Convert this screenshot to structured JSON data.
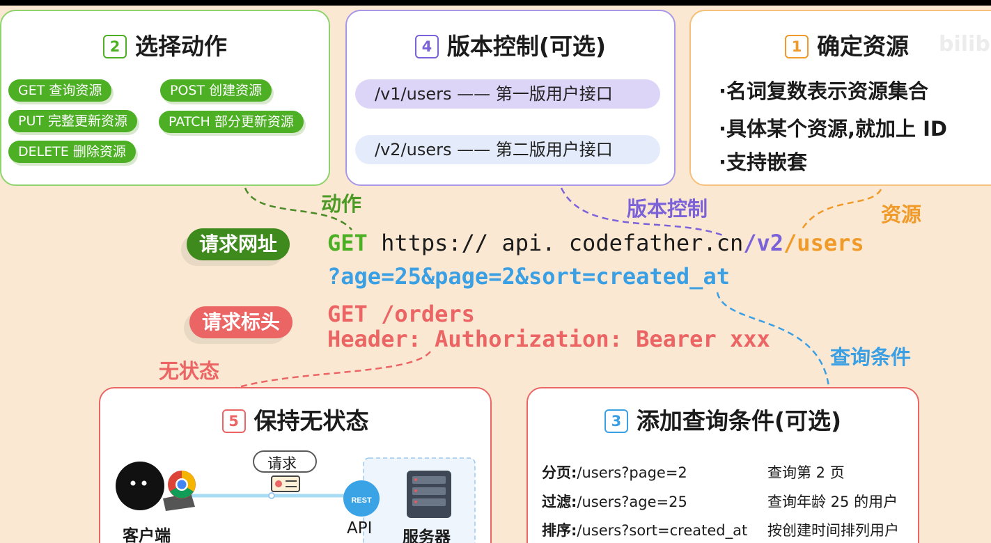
{
  "watermark": "bilib",
  "cards": {
    "actions": {
      "num": "2",
      "title": "选择动作",
      "pills": [
        "GET 查询资源",
        "POST 创建资源",
        "PUT 完整更新资源",
        "PATCH 部分更新资源",
        "DELETE 删除资源"
      ]
    },
    "version": {
      "num": "4",
      "title": "版本控制(可选)",
      "items": [
        "/v1/users —— 第一版用户接口",
        "/v2/users —— 第二版用户接口"
      ]
    },
    "resource": {
      "num": "1",
      "title": "确定资源",
      "bullets": [
        "·名词复数表示资源集合",
        "·具体某个资源,就加上 ID",
        "·支持嵌套"
      ]
    },
    "stateless": {
      "num": "5",
      "title": "保持无状态",
      "request_label": "请求",
      "client": "客户端",
      "api": "API",
      "server": "服务器",
      "rest": "REST"
    },
    "query": {
      "num": "3",
      "title": "添加查询条件(可选)",
      "rows": [
        {
          "label": "分页:",
          "url": "/users?page=2",
          "desc": "查询第 2 页"
        },
        {
          "label": "过滤:",
          "url": "/users?age=25",
          "desc": "查询年龄 25 的用户"
        },
        {
          "label": "排序:",
          "url": "/users?sort=created_at",
          "desc": "按创建时间排列用户"
        }
      ]
    }
  },
  "labels": {
    "action": "动作",
    "version": "版本控制",
    "resource": "资源",
    "stateless": "无状态",
    "query": "查询条件"
  },
  "tags": {
    "url": "请求网址",
    "header": "请求标头"
  },
  "url": {
    "method": "GET",
    "host": "https:// api. codefather.cn",
    "slash": "/",
    "version": "v2",
    "resource": "/users",
    "query": "?age=25&page=2&sort=created_at"
  },
  "header_lines": [
    "GET /orders",
    "Header: Authorization: Bearer xxx"
  ],
  "colors": {
    "green": "#4caf24",
    "purple": "#7b62d8",
    "orange": "#f09a2a",
    "blue": "#3b9fe4",
    "red": "#ec6565",
    "dark_green": "#3f8a1c"
  }
}
